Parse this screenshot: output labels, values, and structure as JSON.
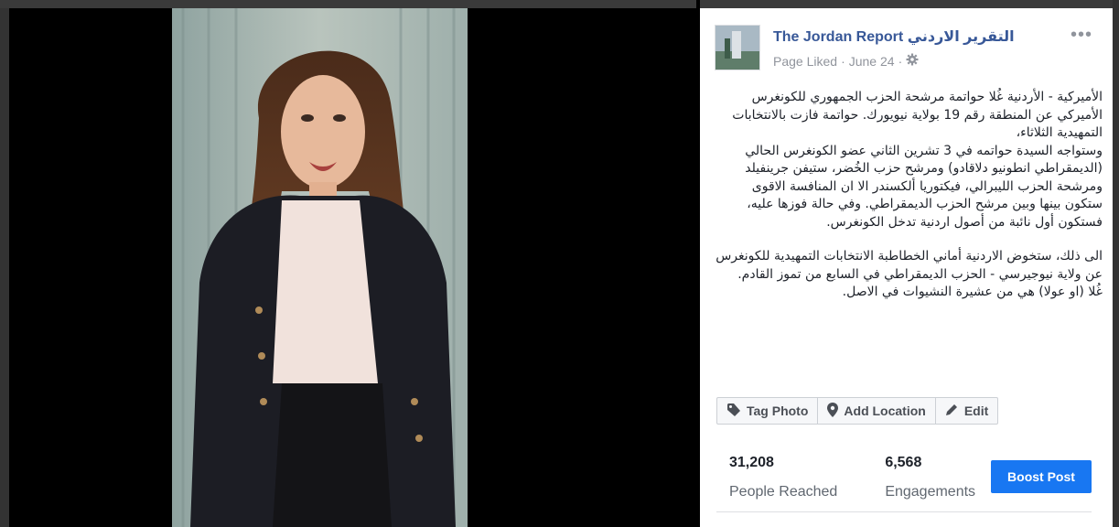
{
  "post": {
    "page_name": "The Jordan Report التقرير الاردني",
    "meta_liked": "Page Liked",
    "meta_sep": "·",
    "meta_date": "June 24",
    "meta_sep2": "·",
    "options_glyph": "•••",
    "text_paragraph_1": "الأميركية - الأردنية غُلا حواتمة مرشحة الحزب الجمهوري للكونغرس الأميركي عن المنطقة رقم 19 بولاية نيويورك. حواتمة فازت بالانتخابات التمهيدية الثلاثاء،\nوستواجه السيدة حواتمه في 3 تشرين الثاني عضو الكونغرس الحالي (الديمقراطي انطونيو دلاقادو) ومرشح حزب الخُضر، ستيفن جرينفيلد ومرشحة الحزب الليبرالي، فيكتوريا ألكسندر الا ان المنافسة الاقوى ستكون بينها وبين مرشح الحزب الديمقراطي. وفي حالة فوزها عليه، فستكون أول نائبة من أصول اردنية تدخل الكونغرس.",
    "text_paragraph_2": "الى ذلك، ستخوض الاردنية أماني الخطاطبة الانتخابات التمهيدية للكونغرس عن ولاية نيوجيرسي - الحزب الديمقراطي في السابع من تموز القادم.\nغُلا (او عولا) هي من عشيرة النشيوات في الاصل."
  },
  "actions": {
    "tag_photo": "Tag Photo",
    "add_location": "Add Location",
    "edit": "Edit"
  },
  "stats": {
    "reached_value": "31,208",
    "reached_label": "People Reached",
    "engagements_value": "6,568",
    "engagements_label": "Engagements"
  },
  "boost_label": "Boost Post",
  "colors": {
    "link": "#385898",
    "boost": "#1877f2",
    "muted": "#90949c"
  },
  "icons": [
    "tag-icon",
    "location-pin-icon",
    "pencil-icon",
    "gear-icon",
    "more-options-icon"
  ]
}
